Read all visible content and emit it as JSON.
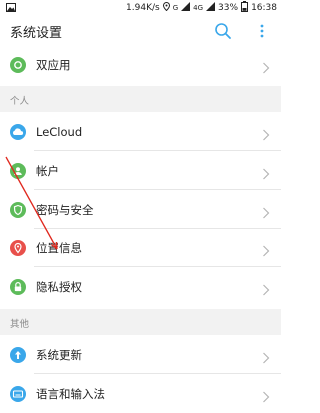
{
  "status_bar": {
    "network_speed": "1.94K/s",
    "network_type": "4G",
    "battery": "33%",
    "time": "16:38"
  },
  "header": {
    "title": "系统设置"
  },
  "items": {
    "dual_apps": "双应用",
    "section_personal": "个人",
    "lecloud": "LeCloud",
    "account": "帐户",
    "security": "密码与安全",
    "location": "位置信息",
    "privacy": "隐私授权",
    "section_other": "其他",
    "system_update": "系统更新",
    "language_input": "语言和输入法"
  },
  "colors": {
    "green": "#5dbb5a",
    "blue": "#3aa7ea",
    "red": "#e8504b",
    "annotation_red": "#e0281e"
  }
}
